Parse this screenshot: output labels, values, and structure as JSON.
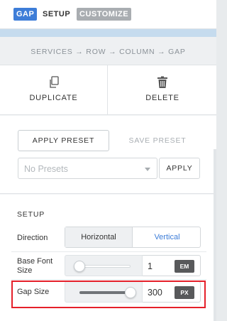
{
  "header": {
    "module_badge": "GAP",
    "tab_setup": "SETUP",
    "tab_customize": "CUSTOMIZE"
  },
  "breadcrumb": "SERVICES → ROW → COLUMN → GAP",
  "actions": {
    "duplicate": "DUPLICATE",
    "delete": "DELETE",
    "duplicate_icon": "duplicate-icon",
    "delete_icon": "trash-icon"
  },
  "presets": {
    "apply_preset": "APPLY PRESET",
    "save_preset": "SAVE PRESET",
    "select_value": "No Presets",
    "apply": "APPLY"
  },
  "setup": {
    "title": "SETUP",
    "direction": {
      "label": "Direction",
      "options": [
        "Horizontal",
        "Vertical"
      ],
      "selected": "Vertical"
    },
    "base_font_size": {
      "label": "Base Font Size",
      "value": "1",
      "unit": "EM",
      "slider_fraction": 0.0
    },
    "gap_size": {
      "label": "Gap Size",
      "value": "300",
      "unit": "PX",
      "slider_fraction": 1.0
    }
  },
  "colors": {
    "accent": "#3d7dd8",
    "highlight": "#e5202a"
  }
}
